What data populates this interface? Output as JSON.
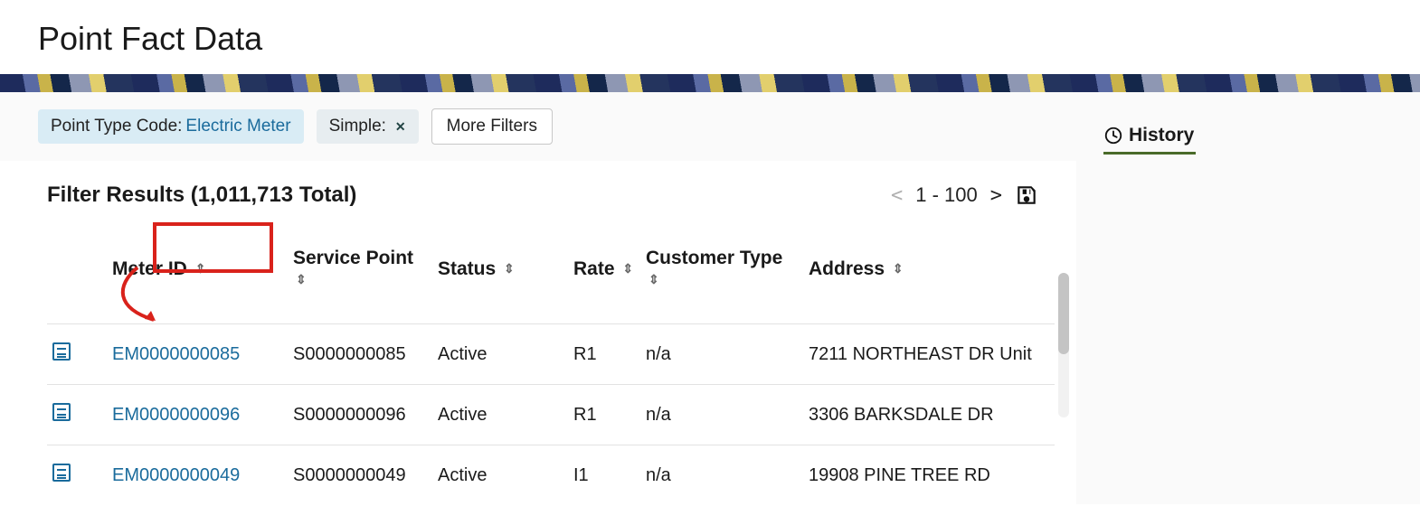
{
  "page_title": "Point Fact Data",
  "filter_chips": {
    "ptc_label": "Point Type Code:",
    "ptc_value": "Electric Meter",
    "simple_label": "Simple:"
  },
  "more_filters_label": "More Filters",
  "results": {
    "heading": "Filter Results (1,011,713 Total)",
    "pager_range": "1 - 100"
  },
  "columns": {
    "meter_id": "Meter ID",
    "service_point": "Service Point",
    "status": "Status",
    "rate": "Rate",
    "customer_type": "Customer Type",
    "address": "Address"
  },
  "rows": [
    {
      "meter_id": "EM0000000085",
      "service_point": "S0000000085",
      "status": "Active",
      "rate": "R1",
      "customer_type": "n/a",
      "address": "7211 NORTHEAST DR Unit"
    },
    {
      "meter_id": "EM0000000096",
      "service_point": "S0000000096",
      "status": "Active",
      "rate": "R1",
      "customer_type": "n/a",
      "address": "3306 BARKSDALE DR"
    },
    {
      "meter_id": "EM0000000049",
      "service_point": "S0000000049",
      "status": "Active",
      "rate": "I1",
      "customer_type": "n/a",
      "address": "19908 PINE TREE RD"
    }
  ],
  "side": {
    "history_label": "History"
  }
}
